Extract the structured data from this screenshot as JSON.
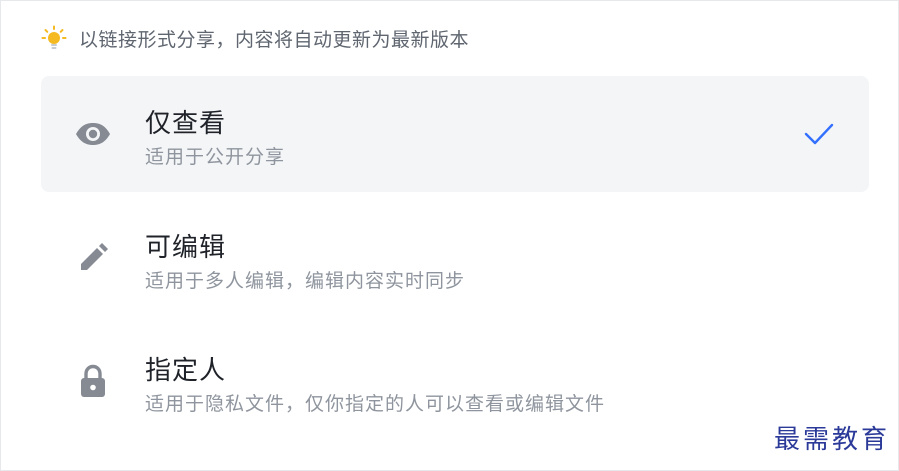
{
  "tip": {
    "icon": "lightbulb-icon",
    "text": "以链接形式分享，内容将自动更新为最新版本",
    "icon_color": "#f5b921"
  },
  "options": [
    {
      "icon": "eye-icon",
      "title": "仅查看",
      "description": "适用于公开分享",
      "selected": true
    },
    {
      "icon": "pencil-icon",
      "title": "可编辑",
      "description": "适用于多人编辑，编辑内容实时同步",
      "selected": false
    },
    {
      "icon": "lock-icon",
      "title": "指定人",
      "description": "适用于隐私文件，仅你指定的人可以查看或编辑文件",
      "selected": false
    }
  ],
  "check_icon": "check-icon",
  "colors": {
    "accent": "#3370ff",
    "selected_bg": "#f4f5f7",
    "icon_gray": "#858a93"
  },
  "watermark": "最需教育"
}
